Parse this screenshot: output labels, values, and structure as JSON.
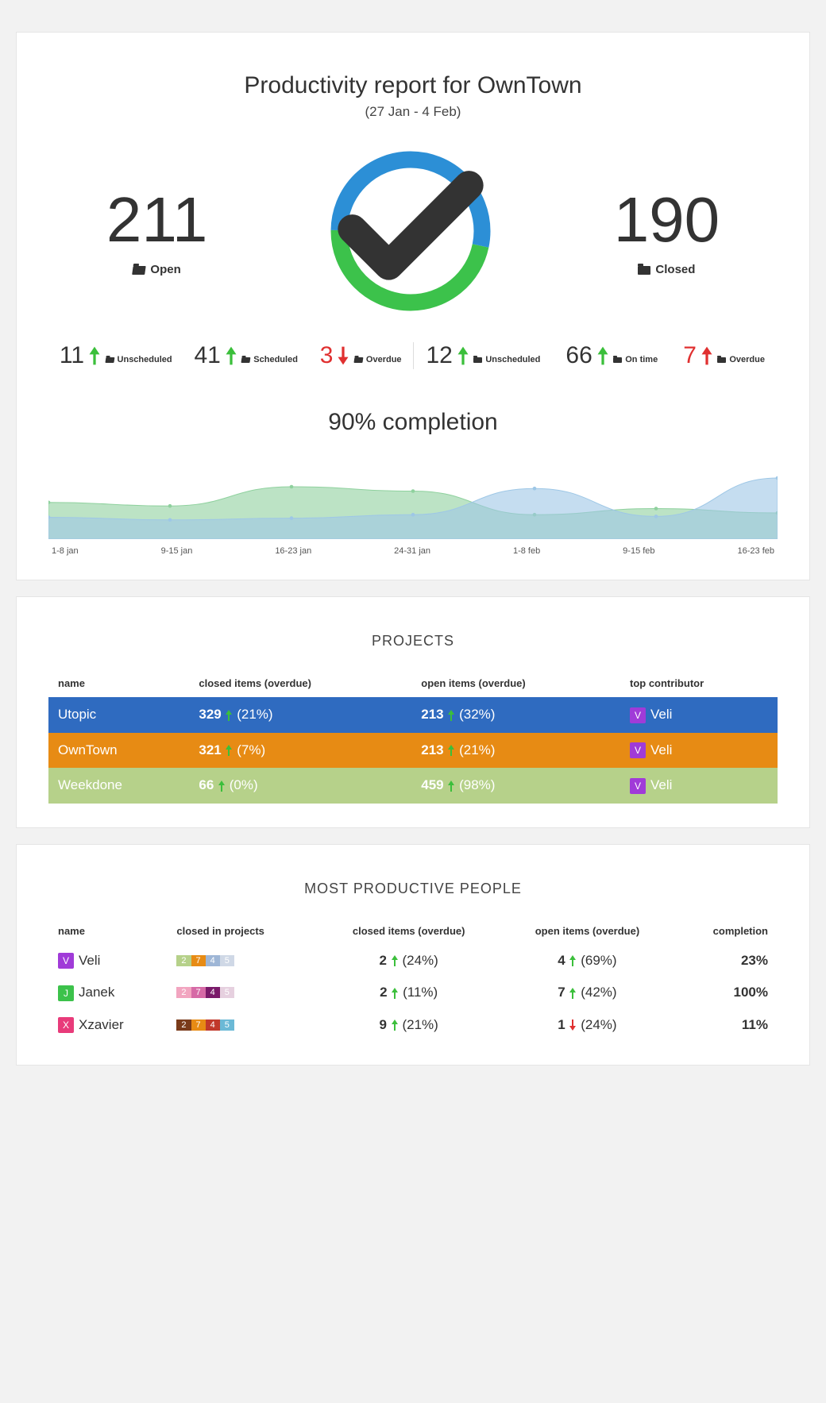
{
  "report": {
    "title": "Productivity report for OwnTown",
    "daterange": "(27 Jan - 4 Feb)",
    "open": {
      "value": "211",
      "label": "Open"
    },
    "closed": {
      "value": "190",
      "label": "Closed"
    },
    "donut": {
      "open_pct": 53,
      "closed_pct": 47,
      "open_color": "#2c8fd6",
      "closed_color": "#3cc24b"
    },
    "open_stats": [
      {
        "value": "11",
        "dir": "up",
        "color": "green",
        "label": "Unscheduled"
      },
      {
        "value": "41",
        "dir": "up",
        "color": "green",
        "label": "Scheduled"
      },
      {
        "value": "3",
        "dir": "down",
        "color": "red",
        "label": "Overdue"
      }
    ],
    "closed_stats": [
      {
        "value": "12",
        "dir": "up",
        "color": "green",
        "label": "Unscheduled"
      },
      {
        "value": "66",
        "dir": "up",
        "color": "green",
        "label": "On time"
      },
      {
        "value": "7",
        "dir": "up",
        "color": "red",
        "label": "Overdue"
      }
    ],
    "completion_title": "90% completion"
  },
  "chart_data": {
    "type": "area",
    "title": "90% completion",
    "x": [
      "1-8 jan",
      "9-15 jan",
      "16-23 jan",
      "24-31 jan",
      "1-8 feb",
      "9-15 feb",
      "16-23 feb"
    ],
    "series": [
      {
        "name": "green",
        "color": "#8fd19e",
        "values": [
          42,
          38,
          60,
          55,
          28,
          35,
          30
        ]
      },
      {
        "name": "blue",
        "color": "#9ec7e6",
        "values": [
          25,
          22,
          24,
          28,
          58,
          26,
          70
        ]
      }
    ],
    "ylim": [
      0,
      100
    ]
  },
  "projects": {
    "header": "PROJECTS",
    "columns": [
      "name",
      "closed items (overdue)",
      "open items (overdue)",
      "top contributor"
    ],
    "rows": [
      {
        "name": "Utopic",
        "color": "#2f6bc0",
        "closed": "329",
        "closed_dir": "up",
        "closed_pct": "(21%)",
        "open": "213",
        "open_dir": "up",
        "open_pct": "(32%)",
        "avatar": "V",
        "avatar_color": "#a03bd8",
        "contributor": "Veli"
      },
      {
        "name": "OwnTown",
        "color": "#e78b14",
        "closed": "321",
        "closed_dir": "up",
        "closed_pct": "(7%)",
        "open": "213",
        "open_dir": "up",
        "open_pct": "(21%)",
        "avatar": "V",
        "avatar_color": "#a03bd8",
        "contributor": "Veli"
      },
      {
        "name": "Weekdone",
        "color": "#b6d18a",
        "closed": "66",
        "closed_dir": "up",
        "closed_pct": "(0%)",
        "open": "459",
        "open_dir": "up",
        "open_pct": "(98%)",
        "avatar": "V",
        "avatar_color": "#a03bd8",
        "contributor": "Veli"
      }
    ]
  },
  "people": {
    "header": "MOST PRODUCTIVE PEOPLE",
    "columns": [
      "name",
      "closed in projects",
      "closed items (overdue)",
      "open items (overdue)",
      "completion"
    ],
    "rows": [
      {
        "avatar": "V",
        "avatar_color": "#a03bd8",
        "name": "Veli",
        "chips": [
          {
            "v": "2",
            "c": "#b6d18a"
          },
          {
            "v": "7",
            "c": "#e78b14"
          },
          {
            "v": "4",
            "c": "#9eb6d6"
          },
          {
            "v": "5",
            "c": "#cfd8e6"
          }
        ],
        "closed": "2",
        "closed_dir": "up",
        "closed_pct": "(24%)",
        "open": "4",
        "open_dir": "up",
        "open_pct": "(69%)",
        "completion": "23%"
      },
      {
        "avatar": "J",
        "avatar_color": "#3cc24b",
        "name": "Janek",
        "chips": [
          {
            "v": "2",
            "c": "#f2a5c0"
          },
          {
            "v": "7",
            "c": "#d66aa6"
          },
          {
            "v": "4",
            "c": "#7a1a6a"
          },
          {
            "v": "5",
            "c": "#e6d0df"
          }
        ],
        "closed": "2",
        "closed_dir": "up",
        "closed_pct": "(11%)",
        "open": "7",
        "open_dir": "up",
        "open_pct": "(42%)",
        "completion": "100%"
      },
      {
        "avatar": "X",
        "avatar_color": "#e83b7a",
        "name": "Xzavier",
        "chips": [
          {
            "v": "2",
            "c": "#7a3b1a"
          },
          {
            "v": "7",
            "c": "#e78b14"
          },
          {
            "v": "4",
            "c": "#c1392b"
          },
          {
            "v": "5",
            "c": "#6bb9d6"
          }
        ],
        "closed": "9",
        "closed_dir": "up",
        "closed_pct": "(21%)",
        "open": "1",
        "open_dir": "down",
        "open_pct": "(24%)",
        "completion": "11%"
      }
    ]
  }
}
